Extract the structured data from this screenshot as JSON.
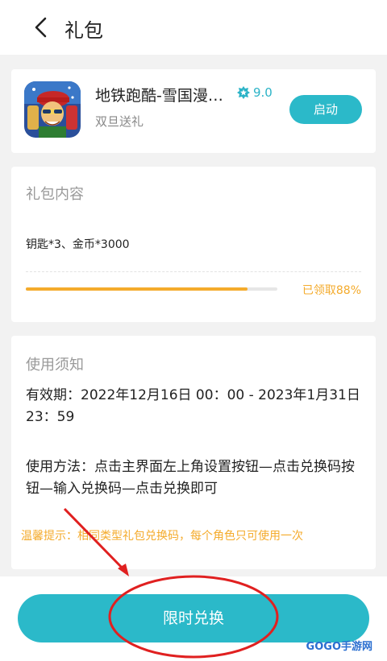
{
  "header": {
    "title": "礼包"
  },
  "app": {
    "name": "地铁跑酷-雪国漫…",
    "rating": "9.0",
    "subtitle": "双旦送礼",
    "launch_label": "启动"
  },
  "content": {
    "title": "礼包内容",
    "text": "钥匙*3、金币*3000",
    "progress_fraction": 0.88,
    "progress_label": "已领取88%"
  },
  "usage": {
    "title": "使用须知",
    "validity": "有效期：2022年12月16日 00：00 - 2023年1月31日 23：59",
    "method": "使用方法：点击主界面左上角设置按钮—点击兑换码按钮—输入兑换码—点击兑换即可",
    "tip": "温馨提示：相同类型礼包兑换码，每个角色只可使用一次"
  },
  "action": {
    "redeem_label": "限时兑换"
  },
  "watermark": "GOGO手游网",
  "colors": {
    "accent": "#2bb9c9",
    "warning": "#f4ab2c",
    "annotation": "#e02020"
  },
  "icons": [
    "back-arrow-icon",
    "star-badge-icon",
    "app-icon"
  ]
}
